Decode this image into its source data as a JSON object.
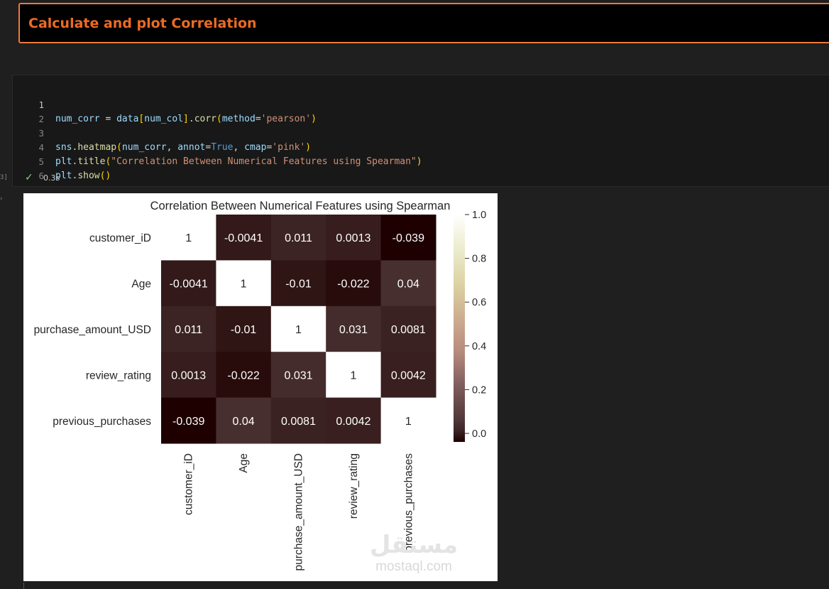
{
  "markdown": {
    "heading": "Calculate and plot Correlation"
  },
  "code_cell": {
    "lines": [
      {
        "n": "1",
        "text": "num_corr = data[num_col].corr(method='pearson')"
      },
      {
        "n": "2",
        "text": ""
      },
      {
        "n": "3",
        "text": "sns.heatmap(num_corr, annot=True, cmap='pink')"
      },
      {
        "n": "4",
        "text": "plt.title(\"Correlation Between Numerical Features using Spearman\")"
      },
      {
        "n": "5",
        "text": "plt.show()"
      },
      {
        "n": "6",
        "text": ""
      }
    ],
    "exec_status": "✓",
    "exec_time": "0.3s",
    "exec_count": "3]"
  },
  "watermark": {
    "logo_text": "مستقل",
    "url": "mostaql.com"
  },
  "chart_data": {
    "type": "heatmap",
    "title": "Correlation Between Numerical Features using Spearman",
    "row_labels": [
      "customer_iD",
      "Age",
      "purchase_amount_USD",
      "review_rating",
      "previous_purchases"
    ],
    "col_labels": [
      "customer_iD",
      "Age",
      "purchase_amount_USD",
      "review_rating",
      "previous_purchases"
    ],
    "values": [
      [
        1,
        -0.0041,
        0.011,
        0.0013,
        -0.039
      ],
      [
        -0.0041,
        1,
        -0.01,
        -0.022,
        0.04
      ],
      [
        0.011,
        -0.01,
        1,
        0.031,
        0.0081
      ],
      [
        0.0013,
        -0.022,
        0.031,
        1,
        0.0042
      ],
      [
        -0.039,
        0.04,
        0.0081,
        0.0042,
        1
      ]
    ],
    "annotations": [
      [
        "1",
        "-0.0041",
        "0.011",
        "0.0013",
        "-0.039"
      ],
      [
        "-0.0041",
        "1",
        "-0.01",
        "-0.022",
        "0.04"
      ],
      [
        "0.011",
        "-0.01",
        "1",
        "0.031",
        "0.0081"
      ],
      [
        "0.0013",
        "-0.022",
        "0.031",
        "1",
        "0.0042"
      ],
      [
        "-0.039",
        "0.04",
        "0.0081",
        "0.0042",
        "1"
      ]
    ],
    "colormap": "pink",
    "vmin": -0.039,
    "vmax": 1.0,
    "colorbar_ticks": [
      "0.0",
      "0.2",
      "0.4",
      "0.6",
      "0.8",
      "1.0"
    ],
    "colorbar_tick_values": [
      0.0,
      0.2,
      0.4,
      0.6,
      0.8,
      1.0
    ],
    "grid": false,
    "legend": "colorbar-right"
  }
}
